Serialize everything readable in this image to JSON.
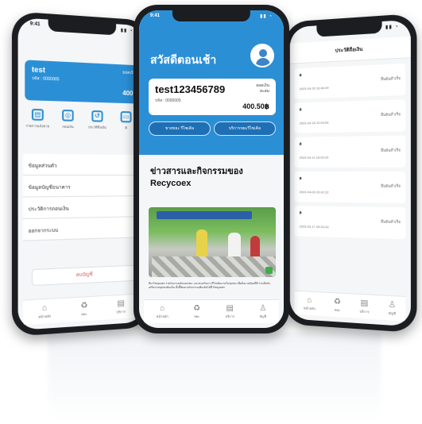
{
  "left_phone": {
    "time": "9:41",
    "user": "test",
    "member_id": "รหัส : 0000005",
    "points_label": "ยอดเงิ",
    "points": "400",
    "icons": [
      {
        "name": "list-icon",
        "label": "รายการแจ้งขาย",
        "glyph": "▤"
      },
      {
        "name": "coin-icon",
        "label": "ถอนเงิน",
        "glyph": "◎"
      },
      {
        "name": "history-icon",
        "label": "ประวัติถือเงิน",
        "glyph": "↺"
      },
      {
        "name": "truck-icon",
        "label": "ติ",
        "glyph": "▭"
      }
    ],
    "menu": [
      "ข้อมูลส่วนตัว",
      "ข้อมูลบัญชีธนาคาร",
      "ประวัติการถอนเงิน",
      "ออกจากระบบ"
    ],
    "logout": "ลบบัญชี",
    "nav": [
      {
        "name": "home-icon",
        "label": "หน้าหลัก",
        "glyph": "⌂"
      },
      {
        "name": "recycle-icon",
        "label": "ขยะ",
        "glyph": "♻"
      },
      {
        "name": "document-icon",
        "label": "บริการ",
        "glyph": "▤"
      }
    ]
  },
  "center_phone": {
    "time": "9:41",
    "greeting": "สวัสดีตอนเช้า",
    "user": "test123456789",
    "member_id": "รหัส : 0000005",
    "points_label_1": "ยอดเงิน",
    "points_label_2": "สะสม",
    "points": "400.50฿",
    "btn_request": "ขายขยะ รีไซเคิล",
    "btn_service": "บริการขยะรีไซเคิล",
    "news_title_1": "ข่าวสารและกิจกรรมของ",
    "news_title_2": "Recycoex",
    "news_text": "ทีม Recycoex ร่วมกิจกรรมคัดแยกขยะ และส่งเสริมการรีไซเคิลภายในชุมชน เพื่อสิ่งแวดล้อมที่ดี ร่วมมือกับเครือข่ายชุมชนท้องถิ่น ทั้งนี้ติดตามกิจกรรมเพิ่มเติมได้ที่ Recycoex",
    "nav": [
      {
        "name": "home-icon",
        "label": "หน้าหลัก",
        "glyph": "⌂"
      },
      {
        "name": "recycle-icon",
        "label": "ขยะ",
        "glyph": "♻"
      },
      {
        "name": "document-icon",
        "label": "บริการ",
        "glyph": "▤"
      },
      {
        "name": "profile-icon",
        "label": "บัญชี",
        "glyph": "♙"
      }
    ]
  },
  "right_phone": {
    "header": "ประวัติถือเงิน",
    "rows": [
      {
        "title": "ล",
        "date": "2023-04-20 16:46:49",
        "status": "ยืนยันสำเร็จ"
      },
      {
        "title": "ล",
        "date": "2023-04-18 22:04:54",
        "status": "ยืนยันสำเร็จ"
      },
      {
        "title": "ล",
        "date": "2023-04-11 16:03:20",
        "status": "ยืนยันสำเร็จ"
      },
      {
        "title": "ล",
        "date": "2023-04-09 23:41:22",
        "status": "ยืนยันสำเร็จ"
      },
      {
        "title": "ล",
        "date": "2023-03-17 09:20:43",
        "status": "ยืนยันสำเร็จ"
      }
    ],
    "nav": [
      {
        "name": "home-icon",
        "label": "หน้าหลัก",
        "glyph": "⌂"
      },
      {
        "name": "recycle-icon",
        "label": "ขยะ",
        "glyph": "♻"
      },
      {
        "name": "document-icon",
        "label": "บริการ",
        "glyph": "▤"
      },
      {
        "name": "profile-icon",
        "label": "บัญชี",
        "glyph": "♙"
      }
    ]
  },
  "colors": {
    "primary": "#2b8fd6",
    "dark": "#1f6fb5",
    "danger": "#d9534f"
  }
}
